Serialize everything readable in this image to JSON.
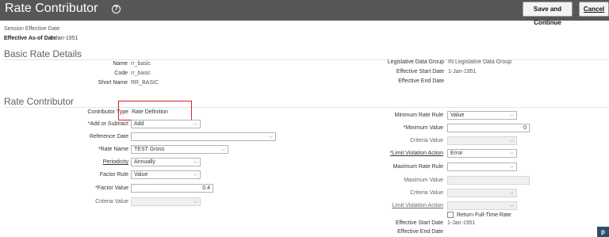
{
  "header": {
    "title": "Rate Contributor",
    "help_icon": "?",
    "save_continue": "Save and Continue",
    "cancel": "Cancel"
  },
  "session": {
    "label": "Session Effective Date",
    "effective_label": "Effective As-of Date",
    "effective_value": "1-Jan-1951"
  },
  "basic": {
    "title": "Basic Rate Details",
    "name_label": "Name",
    "name_value": "rr_basic",
    "code_label": "Code",
    "code_value": "rr_basic",
    "short_label": "Short Name",
    "short_value": "RR_BASIC",
    "ldg_label": "Legislative Data Group",
    "ldg_value": "IN Legislative Data Group",
    "start_label": "Effective Start Date",
    "start_value": "1-Jan-1951",
    "end_label": "Effective End Date"
  },
  "contrib": {
    "title": "Rate Contributor",
    "type_label": "Contributor Type",
    "type_value": "Rate Definition",
    "add_label": "Add or Subtract",
    "add_value": "Add",
    "ref_label": "Reference Date",
    "ref_value": "",
    "rate_name_label": "Rate Name",
    "rate_name_value": "TEST Gross",
    "period_label": "Periodicity",
    "period_value": "Annually",
    "factor_rule_label": "Factor Rule",
    "factor_rule_value": "Value",
    "factor_value_label": "Factor Value",
    "factor_value_value": "0.4",
    "criteria_label": "Criteria Value",
    "min_rule_label": "Minimum Rate Rule",
    "min_rule_value": "Value",
    "min_value_label": "Minimum Value",
    "min_value_value": "0",
    "min_criteria_label": "Criteria Value",
    "limit_label": "Limit Violation Action",
    "limit_value": "Error",
    "max_rule_label": "Maximum Rate Rule",
    "max_value_label": "Maximum Value",
    "max_criteria_label": "Criteria Value",
    "max_limit_label": "Limit Violation Action",
    "return_label": "Return Full-Time Rate",
    "start_label": "Effective Start Date",
    "start_value": "1-Jan-1951",
    "end_label": "Effective End Date"
  },
  "corner_glyph": "p"
}
